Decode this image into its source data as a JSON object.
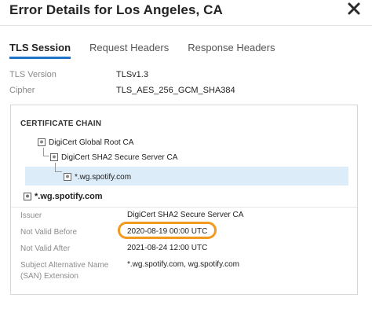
{
  "dialog": {
    "title": "Error Details for Los Angeles, CA"
  },
  "tabs": [
    {
      "label": "TLS Session",
      "active": true
    },
    {
      "label": "Request Headers",
      "active": false
    },
    {
      "label": "Response Headers",
      "active": false
    }
  ],
  "tls": {
    "version_label": "TLS Version",
    "version_value": "TLSv1.3",
    "cipher_label": "Cipher",
    "cipher_value": "TLS_AES_256_GCM_SHA384"
  },
  "certificate_chain": {
    "title": "CERTIFICATE CHAIN",
    "items": [
      {
        "label": "DigiCert Global Root CA"
      },
      {
        "label": "DigiCert SHA2 Secure Server CA"
      },
      {
        "label": "*.wg.spotify.com"
      }
    ]
  },
  "certificate_details": {
    "subject": "*.wg.spotify.com",
    "issuer_label": "Issuer",
    "issuer_value": "DigiCert SHA2 Secure Server CA",
    "not_before_label": "Not Valid Before",
    "not_before_value": "2020-08-19 00:00 UTC",
    "not_after_label": "Not Valid After",
    "not_after_value": "2021-08-24 12:00 UTC",
    "san_label_line1": "Subject Alternative Name",
    "san_label_line2": "(SAN) Extension",
    "san_value": "*.wg.spotify.com, wg.spotify.com"
  },
  "colors": {
    "tab_accent": "#1f73c8",
    "selection_bg": "#dcecf8",
    "highlight_ring": "#f29a1f"
  },
  "icons": {
    "close": "close-icon",
    "certificate": "certificate-icon"
  }
}
